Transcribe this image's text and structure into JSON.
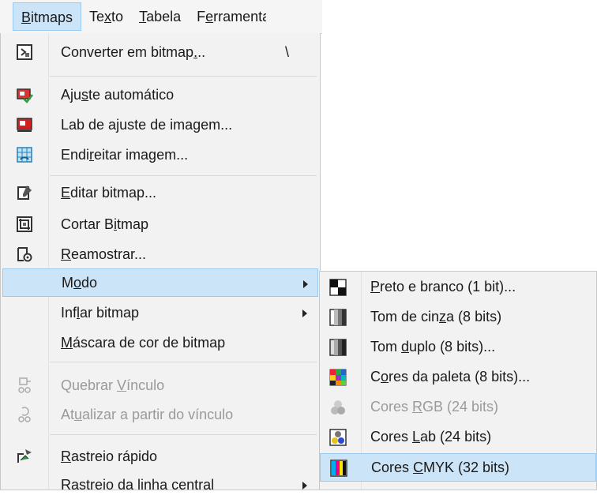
{
  "menubar": {
    "items": [
      {
        "pre": "",
        "u": "B",
        "post": "itmaps"
      },
      {
        "pre": "Te",
        "u": "x",
        "post": "to"
      },
      {
        "pre": "",
        "u": "T",
        "post": "abela"
      },
      {
        "pre": "F",
        "u": "e",
        "post": "rramenta"
      }
    ]
  },
  "menu": {
    "items": [
      {
        "pre": "Converter em bitmap",
        "u": ".",
        "post": "..",
        "shortcut": "\\",
        "icon": "convert-bitmap-icon"
      },
      {
        "pre": "Aju",
        "u": "s",
        "post": "te automático",
        "icon": "auto-adjust-icon"
      },
      {
        "pre": "Lab de ajuste de imagem...",
        "u": "",
        "post": "",
        "icon": "image-adjust-lab-icon"
      },
      {
        "pre": "Endi",
        "u": "r",
        "post": "eitar imagem...",
        "icon": "straighten-image-icon"
      },
      {
        "pre": "",
        "u": "E",
        "post": "ditar bitmap...",
        "icon": "edit-bitmap-icon"
      },
      {
        "pre": "Cortar B",
        "u": "i",
        "post": "tmap",
        "icon": "crop-bitmap-icon"
      },
      {
        "pre": "",
        "u": "R",
        "post": "eamostrar...",
        "icon": "resample-icon"
      },
      {
        "pre": "M",
        "u": "o",
        "post": "do",
        "icon": ""
      },
      {
        "pre": "Inf",
        "u": "l",
        "post": "ar bitmap",
        "icon": ""
      },
      {
        "pre": "",
        "u": "M",
        "post": "áscara de cor de bitmap",
        "icon": ""
      },
      {
        "pre": "Quebrar ",
        "u": "V",
        "post": "ínculo",
        "icon": "break-link-icon"
      },
      {
        "pre": "At",
        "u": "u",
        "post": "alizar a partir do vínculo",
        "icon": "update-link-icon"
      },
      {
        "pre": "",
        "u": "R",
        "post": "astreio rápido",
        "icon": "quick-trace-icon"
      },
      {
        "pre": "Rastreio da linha central",
        "u": "",
        "post": "",
        "icon": ""
      }
    ]
  },
  "submenu": {
    "items": [
      {
        "pre": "",
        "u": "P",
        "post": "reto e branco (1 bit)...",
        "icon": "black-white-icon"
      },
      {
        "pre": "Tom de cin",
        "u": "z",
        "post": "a (8 bits)",
        "icon": "grayscale-icon"
      },
      {
        "pre": "Tom ",
        "u": "d",
        "post": "uplo (8 bits)...",
        "icon": "duotone-icon"
      },
      {
        "pre": "C",
        "u": "o",
        "post": "res da paleta (8 bits)...",
        "icon": "paletted-icon"
      },
      {
        "pre": "Cores ",
        "u": "R",
        "post": "GB (24 bits)",
        "icon": "rgb-icon"
      },
      {
        "pre": "Cores ",
        "u": "L",
        "post": "ab (24 bits)",
        "icon": "lab-color-icon"
      },
      {
        "pre": "Cores ",
        "u": "C",
        "post": "MYK (32 bits)",
        "icon": "cmyk-icon"
      }
    ]
  },
  "colors": {
    "highlight": "#cce4f7",
    "highlight_border": "#99c9ef",
    "menu_bg": "#f2f2f2",
    "disabled_text": "#9a9a9a"
  }
}
